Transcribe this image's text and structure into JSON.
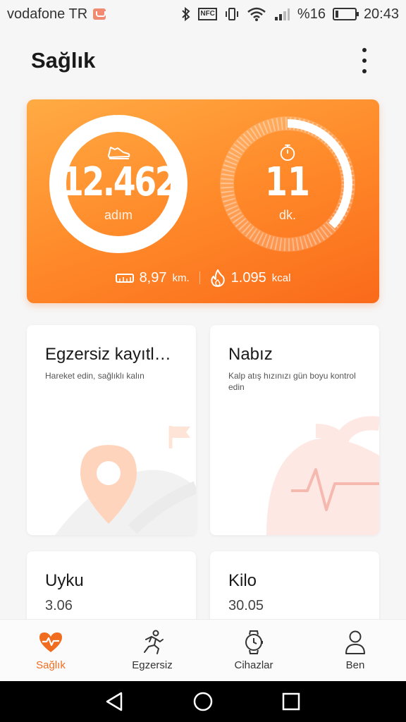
{
  "status_bar": {
    "carrier": "vodafone TR",
    "battery_percent": "%16",
    "battery_level": 0.16,
    "time": "20:43",
    "icons": [
      "mail-icon",
      "bluetooth-icon",
      "nfc-icon",
      "vibrate-icon",
      "wifi-icon",
      "signal-icon",
      "battery-charging-icon"
    ],
    "nfc_label": "NFC"
  },
  "header": {
    "title": "Sağlık",
    "menu_icon": "more-vertical-icon"
  },
  "colors": {
    "accent": "#f06d1f",
    "hero_gradient_start": "#ffab44",
    "hero_gradient_end": "#fa6a1a"
  },
  "activity": {
    "steps": {
      "value": "12.462",
      "unit": "adım",
      "icon": "shoe-icon",
      "progress": 0.99
    },
    "time": {
      "value": "11",
      "unit": "dk.",
      "icon": "stopwatch-icon",
      "progress": 0.37
    },
    "distance": {
      "value": "8,97",
      "unit": "km.",
      "icon": "ruler-icon"
    },
    "calories": {
      "value": "1.095",
      "unit": "kcal",
      "icon": "flame-icon"
    }
  },
  "cards": [
    {
      "title": "Egzersiz kayıtl…",
      "subtitle": "Hareket edin, sağlıklı kalın",
      "illustration": "map-pin-flag-icon"
    },
    {
      "title": "Nabız",
      "subtitle": "Kalp atış hızınızı gün boyu kontrol edin",
      "illustration": "heartbeat-icon"
    },
    {
      "title": "Uyku",
      "value": "3.06"
    },
    {
      "title": "Kilo",
      "value": "30.05"
    }
  ],
  "bottom_nav": [
    {
      "label": "Sağlık",
      "icon": "heart-pulse-icon",
      "active": true
    },
    {
      "label": "Egzersiz",
      "icon": "running-icon",
      "active": false
    },
    {
      "label": "Cihazlar",
      "icon": "watch-icon",
      "active": false
    },
    {
      "label": "Ben",
      "icon": "person-icon",
      "active": false
    }
  ],
  "system_nav": [
    "back-icon",
    "home-icon",
    "recents-icon"
  ]
}
